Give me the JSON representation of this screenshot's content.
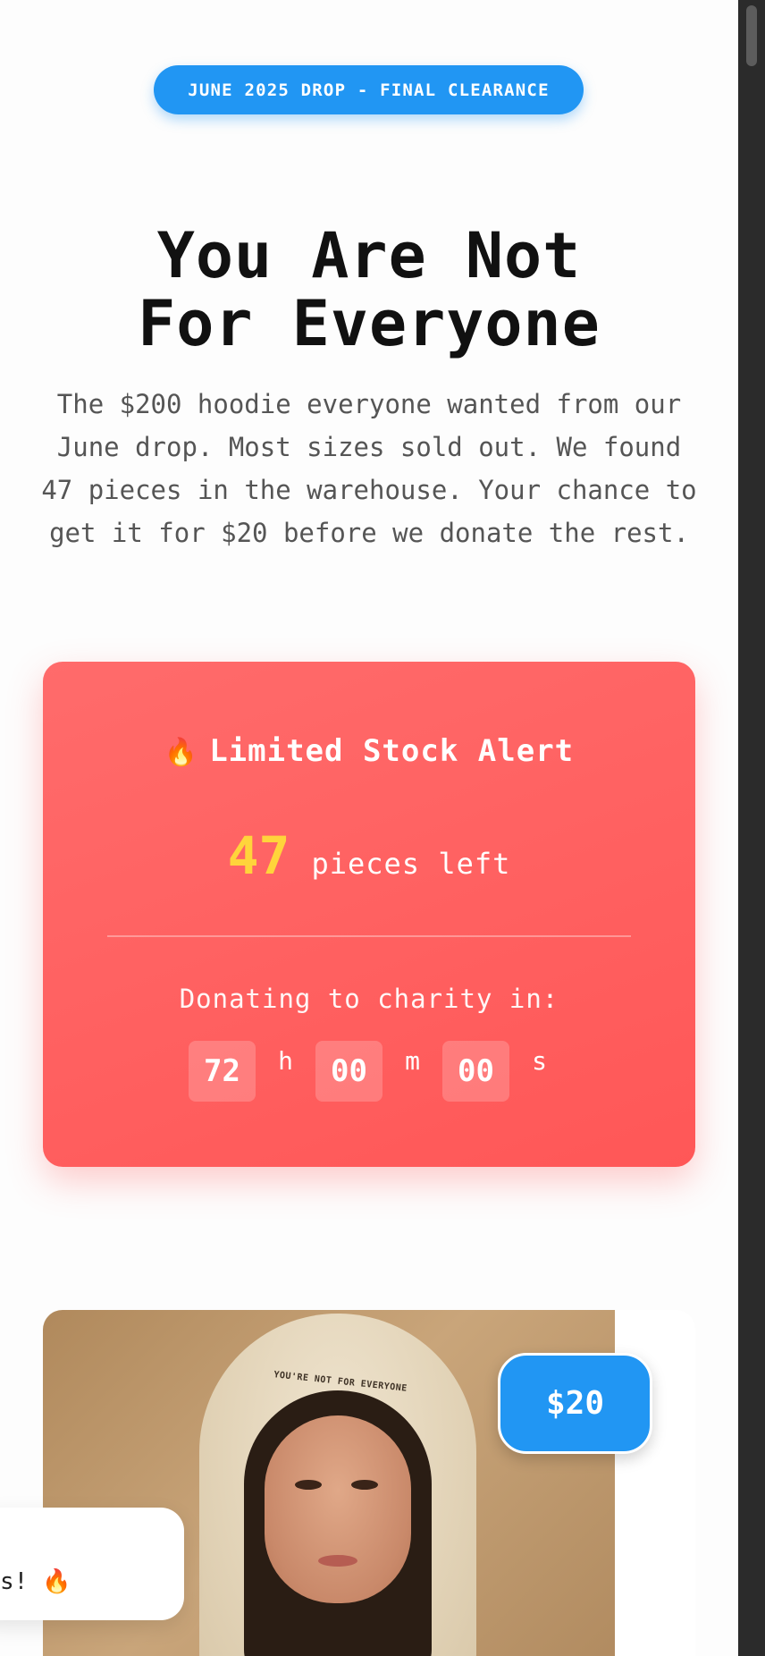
{
  "banner": {
    "label": "JUNE 2025 DROP - FINAL CLEARANCE"
  },
  "hero": {
    "title_line1": "You Are Not",
    "title_line2": "For Everyone",
    "description": "The $200 hoodie everyone wanted from our June drop. Most sizes sold out. We found 47 pieces in the warehouse. Your chance to get it for $20 before we donate the rest."
  },
  "alert": {
    "icon": "fire-icon",
    "title": "Limited Stock Alert",
    "stock_count": "47",
    "stock_label": "pieces left",
    "donate_label": "Donating to charity in:",
    "timer": {
      "hours": "72",
      "hours_unit": "h",
      "minutes": "00",
      "minutes_unit": "m",
      "seconds": "00",
      "seconds_unit": "s"
    }
  },
  "product": {
    "price": "$20",
    "hood_print": "YOU'RE NOT FOR EVERYONE"
  },
  "toast": {
    "text": "s! 🔥"
  },
  "colors": {
    "accent": "#2196f3",
    "alert": "#ff5e5e",
    "stock_highlight": "#ffd43b"
  }
}
